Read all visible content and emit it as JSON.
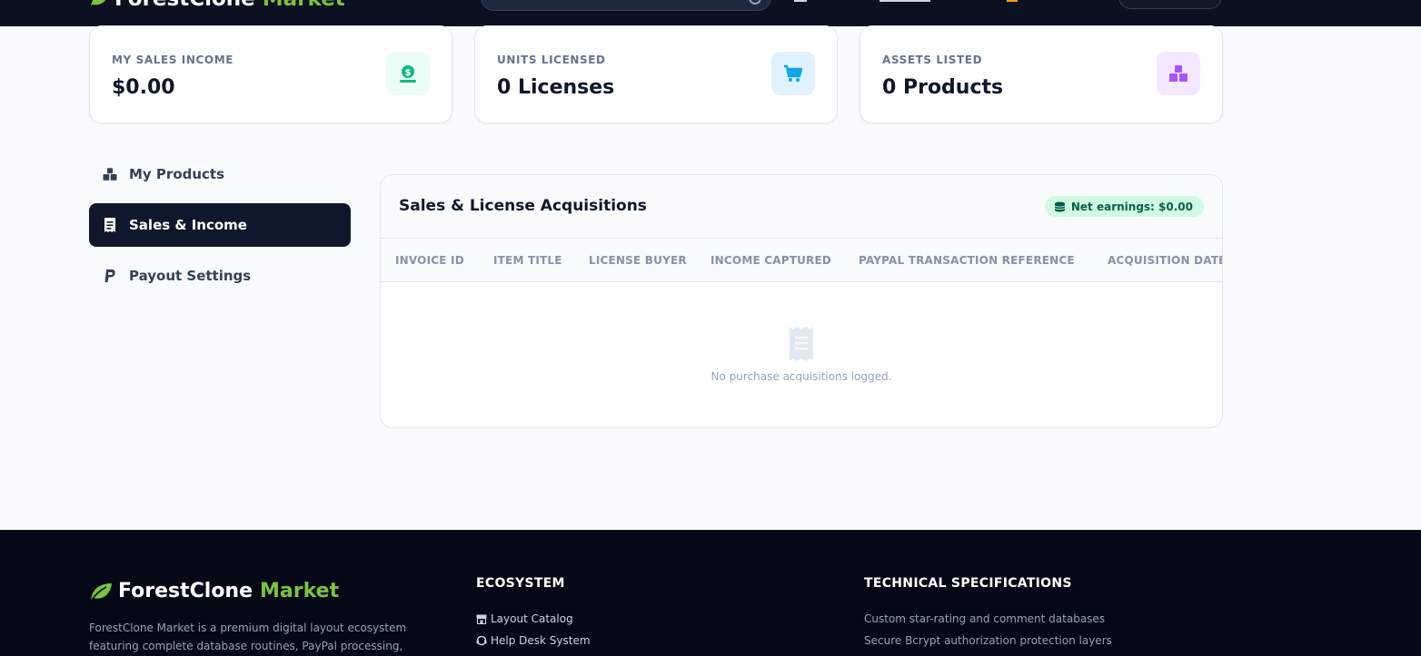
{
  "header": {
    "brand_name": "ForestClone",
    "brand_accent": "Market"
  },
  "stats": [
    {
      "label": "MY SALES INCOME",
      "value": "$0.00",
      "icon": "money-icon",
      "icon_color": "#10b981",
      "icon_bg": "#ecfdf5"
    },
    {
      "label": "UNITS LICENSED",
      "value": "0 Licenses",
      "icon": "cart-icon",
      "icon_color": "#0ea5e9",
      "icon_bg": "#e0f2fe"
    },
    {
      "label": "ASSETS LISTED",
      "value": "0 Products",
      "icon": "boxes-icon",
      "icon_color": "#a855f7",
      "icon_bg": "#f3e8ff"
    }
  ],
  "sidebar": {
    "items": [
      {
        "label": "My Products",
        "icon": "boxes-icon",
        "active": false
      },
      {
        "label": "Sales & Income",
        "icon": "receipt-icon",
        "active": true
      },
      {
        "label": "Payout Settings",
        "icon": "paypal-icon",
        "active": false
      }
    ]
  },
  "sales": {
    "title": "Sales & License Acquisitions",
    "earnings_badge": "Net earnings: $0.00",
    "columns": [
      "INVOICE ID",
      "ITEM TITLE",
      "LICENSE BUYER",
      "INCOME CAPTURED",
      "PAYPAL TRANSACTION REFERENCE",
      "ACQUISITION DATE"
    ],
    "empty_message": "No purchase acquisitions logged."
  },
  "footer": {
    "brand_name": "ForestClone",
    "brand_accent": "Market",
    "description": "ForestClone Market is a premium digital layout ecosystem featuring complete database routines, PayPal processing, changelogs, star reviews,",
    "ecosystem_heading": "ECOSYSTEM",
    "ecosystem_links": [
      "Layout Catalog",
      "Help Desk System"
    ],
    "specs_heading": "TECHNICAL SPECIFICATIONS",
    "specs": [
      "Custom star-rating and comment databases",
      "Secure Bcrypt authorization protection layers"
    ]
  },
  "colors": {
    "brand_accent": "#7cc242",
    "nav_dark": "#0b1120",
    "active_item": "#0f172a",
    "earnings_badge_bg": "#d1fae5",
    "earnings_badge_text": "#065f46"
  }
}
